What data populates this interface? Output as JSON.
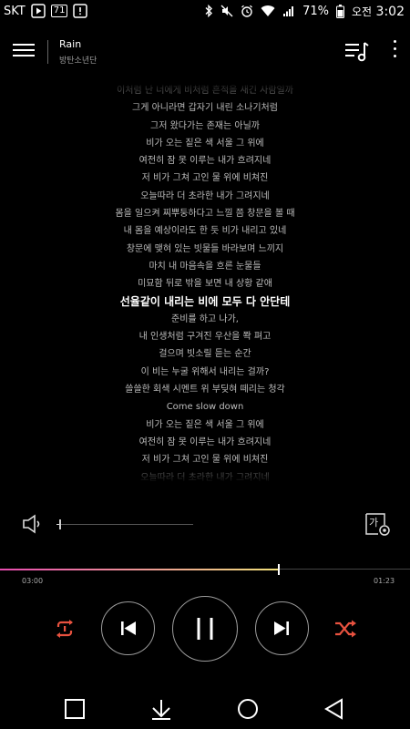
{
  "status": {
    "carrier": "SKT",
    "badge": "71",
    "battery": "71%",
    "ampm": "오전",
    "time": "3:02"
  },
  "appbar": {
    "title": "Rain",
    "artist": "방탄소년단"
  },
  "lyrics": {
    "lines": [
      "이처럼 난 너에게 비처럼 흔적을 새긴 사람일까",
      "그게 아니라면 갑자기 내린 소나기처럼",
      "그저 왔다가는 존재는 아닐까",
      "비가 오는 짙은 색 서울 그 위에",
      "여전히 잠 못 이루는 내가 흐려지네",
      "저 비가 그쳐 고인 물 위에 비쳐진",
      "오늘따라 더 초라한 내가 그려지네",
      "몸을 일으켜 찌뿌둥하다고 느낄 쯤 창문을 볼 때",
      "내 몸을 예상이라도 한 듯 비가 내리고 있네",
      "창문에 맺혀 있는 빗물들 바라보며 느끼지",
      "마치 내 마음속을 흐른 눈물들",
      "미묘함 뒤로 밖을 보면 내 상황 같애",
      "선율같이 내리는 비에 모두 다 안단테",
      "준비를 하고 나가,",
      "내 인생처럼 구겨진 우산을 쫙 펴고",
      "걸으며 빗소릴 듣는 순간",
      "이 비는 누굴 위해서 내리는 걸까?",
      "쓸쓸한 회색 시멘트 위 부딪혀 떼리는 청각",
      "Come slow down",
      "비가 오는 짙은 색 서울 그 위에",
      "여전히 잠 못 이루는 내가 흐려지네",
      "저 비가 그쳐 고인 물 위에 비쳐진",
      "오늘따라 더 초라한 내가 그려지네"
    ],
    "current_index": 12
  },
  "volume": {
    "level": 0.02
  },
  "lyric_size_label": "가",
  "progress": {
    "elapsed": "03:00",
    "total": "01:23",
    "fraction": 0.68
  },
  "colors": {
    "accent": "#e8523f",
    "progress_start": "#e84bb0",
    "progress_end": "#f0e07a"
  },
  "icons": [
    "menu-icon",
    "playlist-icon",
    "more-vert-icon",
    "volume-icon",
    "lyric-size-icon",
    "repeat-icon",
    "previous-icon",
    "pause-icon",
    "next-icon",
    "shuffle-icon",
    "nav-recents-icon",
    "nav-down-icon",
    "nav-home-icon",
    "nav-back-icon"
  ]
}
